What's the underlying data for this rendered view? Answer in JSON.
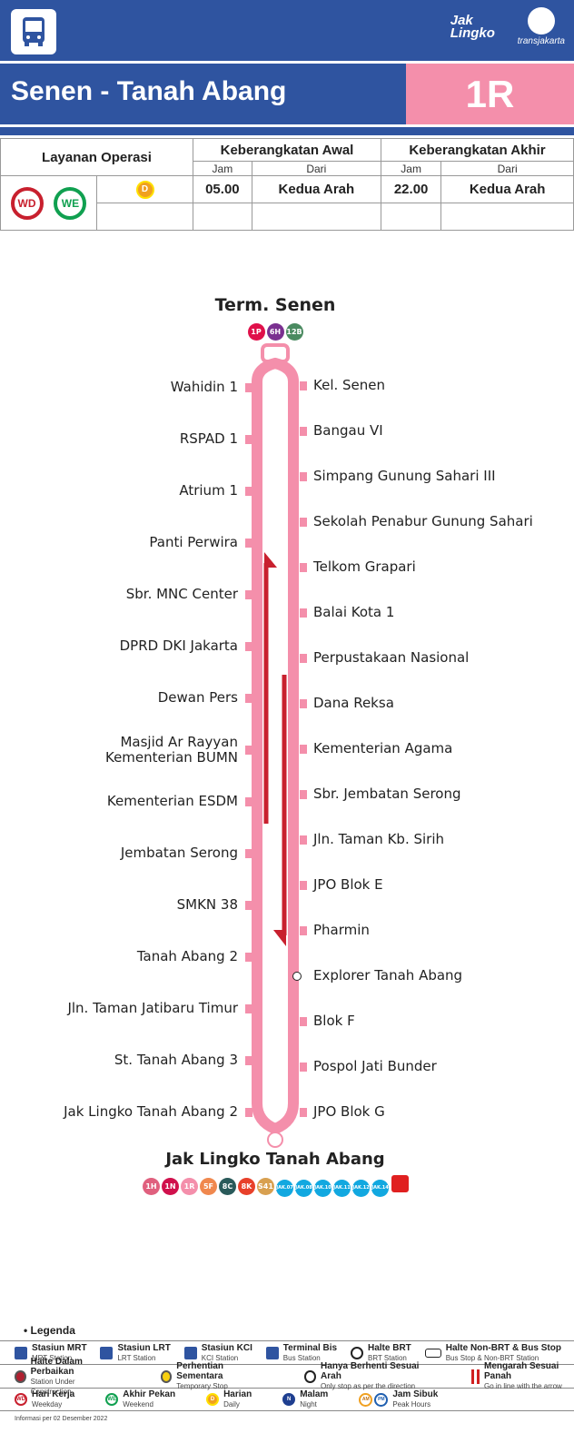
{
  "header": {
    "logo_jaklingko": "Jak Lingko",
    "logo_transjakarta": "transjakarta",
    "route_name": "Senen - Tanah Abang",
    "route_code": "1R",
    "route_color": "#f48fab",
    "brand_color": "#2f54a0"
  },
  "schedule": {
    "service_label": "Layanan Operasi",
    "first_label": "Keberangkatan Awal",
    "last_label": "Keberangkatan Akhir",
    "jam": "Jam",
    "dari": "Dari",
    "service_badges": [
      "WD",
      "WE",
      "D"
    ],
    "first_time": "05.00",
    "first_from": "Kedua Arah",
    "last_time": "22.00",
    "last_from": "Kedua Arah"
  },
  "map": {
    "start": {
      "name": "Term. Senen",
      "connections": [
        {
          "code": "1P",
          "color": "#e0104a"
        },
        {
          "code": "6H",
          "color": "#7a3090"
        },
        {
          "code": "12B",
          "color": "#4a8a60"
        }
      ]
    },
    "left_stops": [
      "Wahidin 1",
      "RSPAD 1",
      "Atrium 1",
      "Panti Perwira",
      "Sbr. MNC Center",
      "DPRD DKI Jakarta",
      "Dewan Pers",
      "Masjid Ar Rayyan\nKementerian BUMN",
      "Kementerian ESDM",
      "Jembatan Serong",
      "SMKN 38",
      "Tanah Abang 2",
      "Jln. Taman Jatibaru Timur",
      "St. Tanah Abang 3",
      "Jak Lingko Tanah Abang 2"
    ],
    "right_stops": [
      "Kel. Senen",
      "Bangau VI",
      "Simpang Gunung Sahari III",
      "Sekolah Penabur Gunung Sahari",
      "Telkom Grapari",
      "Balai Kota 1",
      "Perpustakaan Nasional",
      "Dana Reksa",
      "Kementerian Agama",
      "Sbr. Jembatan Serong",
      "Jln. Taman Kb. Sirih",
      "JPO Blok E",
      "Pharmin",
      "Explorer Tanah Abang",
      "Blok F",
      "Pospol Jati Bunder",
      "JPO Blok G"
    ],
    "brt_stop_right": "Explorer Tanah Abang",
    "end": {
      "name": "Jak Lingko Tanah Abang",
      "connections": [
        {
          "code": "1H",
          "color": "#e0607e"
        },
        {
          "code": "1N",
          "color": "#d0104c"
        },
        {
          "code": "1R",
          "color": "#f48fab"
        },
        {
          "code": "5F",
          "color": "#f0884e"
        },
        {
          "code": "8C",
          "color": "#2a5a5a"
        },
        {
          "code": "8K",
          "color": "#e8402a"
        },
        {
          "code": "S41",
          "color": "#d8a050"
        },
        {
          "code": "JAK.07",
          "color": "#12a8e0"
        },
        {
          "code": "JAK.08",
          "color": "#12a8e0"
        },
        {
          "code": "JAK.10",
          "color": "#12a8e0"
        },
        {
          "code": "JAK.11",
          "color": "#12a8e0"
        },
        {
          "code": "JAK.12",
          "color": "#12a8e0"
        },
        {
          "code": "JAK.14",
          "color": "#12a8e0"
        }
      ]
    }
  },
  "legend": {
    "title": "Legenda",
    "items": [
      {
        "t": "Stasiun MRT",
        "s": "MRT Station"
      },
      {
        "t": "Stasiun LRT",
        "s": "LRT Station"
      },
      {
        "t": "Stasiun KCI",
        "s": "KCI Station"
      },
      {
        "t": "Terminal Bis",
        "s": "Bus Station"
      },
      {
        "t": "Halte BRT",
        "s": "BRT Station"
      },
      {
        "t": "Halte Non-BRT & Bus Stop",
        "s": "Bus Stop & Non-BRT Station"
      },
      {
        "t": "Halte Dalam Perbaikan",
        "s": "Station Under Construction"
      },
      {
        "t": "Perhentian Sementara",
        "s": "Temporary Stop"
      },
      {
        "t": "Hanya Berhenti Sesuai Arah",
        "s": "Only stop as per the direction"
      },
      {
        "t": "Mengarah Sesuai Panah",
        "s": "Go in line with the arrow"
      },
      {
        "t": "Hari Kerja",
        "s": "Weekday"
      },
      {
        "t": "Akhir Pekan",
        "s": "Weekend"
      },
      {
        "t": "Harian",
        "s": "Daily"
      },
      {
        "t": "Malam",
        "s": "Night"
      },
      {
        "t": "Jam Sibuk",
        "s": "Peak Hours"
      }
    ],
    "badges": {
      "wd": "WD",
      "we": "WE",
      "d": "D",
      "n": "N",
      "am": "AM",
      "pm": "PM"
    },
    "footnote": "Informasi per 02 Desember 2022"
  }
}
